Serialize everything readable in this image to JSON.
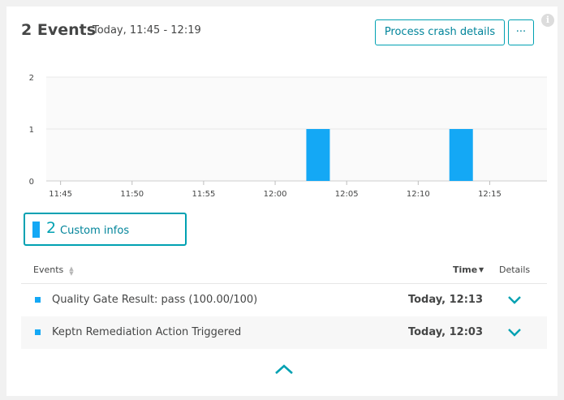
{
  "header": {
    "title": "2 Events",
    "time_range": "Today, 11:45 - 12:19",
    "process_button": "Process crash details",
    "more_button": "···",
    "info_icon": "i"
  },
  "chart_data": {
    "type": "bar",
    "x_ticks": [
      "11:45",
      "11:50",
      "11:55",
      "12:00",
      "12:05",
      "12:10",
      "12:15"
    ],
    "y_ticks": [
      "0",
      "1",
      "2"
    ],
    "ylim": [
      0,
      2
    ],
    "xlim": [
      "11:44",
      "12:19"
    ],
    "bars": [
      {
        "x": "12:03",
        "value": 1
      },
      {
        "x": "12:13",
        "value": 1
      }
    ],
    "bar_color": "#14a8f5",
    "grid": true
  },
  "legend": {
    "count": "2",
    "label": "Custom infos"
  },
  "table": {
    "columns": {
      "events": "Events",
      "time": "Time",
      "details": "Details"
    },
    "rows": [
      {
        "name": "Quality Gate Result: pass (100.00/100)",
        "time": "Today, 12:13"
      },
      {
        "name": "Keptn Remediation Action Triggered",
        "time": "Today, 12:03"
      }
    ]
  },
  "icons": {
    "info": "info-icon",
    "sort": "sort-icon",
    "sort_desc": "caret-down-icon",
    "expand": "chevron-down-icon",
    "collapse": "chevron-up-icon"
  },
  "colors": {
    "accent": "#00a1b2",
    "bar": "#14a8f5",
    "text": "#454646"
  }
}
